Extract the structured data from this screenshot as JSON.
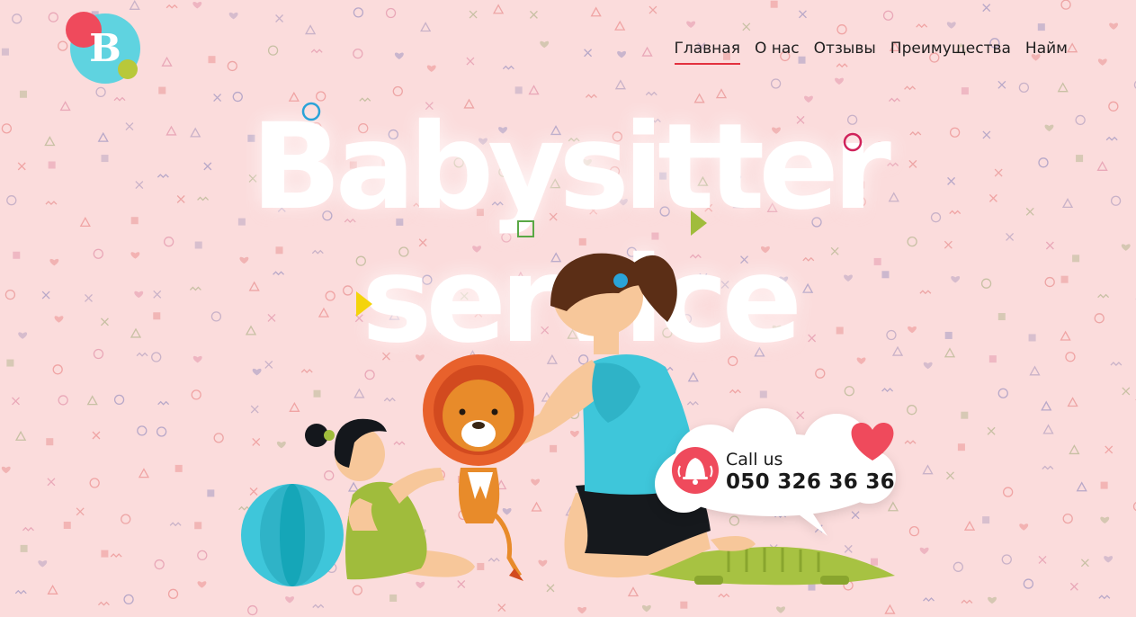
{
  "brand": {
    "logo_letter": "B"
  },
  "nav": {
    "items": [
      {
        "label": "Главная",
        "active": true
      },
      {
        "label": "О нас",
        "active": false
      },
      {
        "label": "Отзывы",
        "active": false
      },
      {
        "label": "Преимущества",
        "active": false
      },
      {
        "label": "Найм",
        "active": false
      }
    ]
  },
  "hero": {
    "title_line1": "Babysitter",
    "title_line2": "service"
  },
  "call": {
    "label": "Call us",
    "phone": "050 326 36 36"
  },
  "colors": {
    "background": "#fbdcdc",
    "accent_red": "#e3313f",
    "logo_cyan": "#5fd3e0",
    "logo_red": "#ef4a5c",
    "logo_lime": "#b8c83a",
    "teal": "#33bdd4",
    "green": "#a0bc3c"
  }
}
